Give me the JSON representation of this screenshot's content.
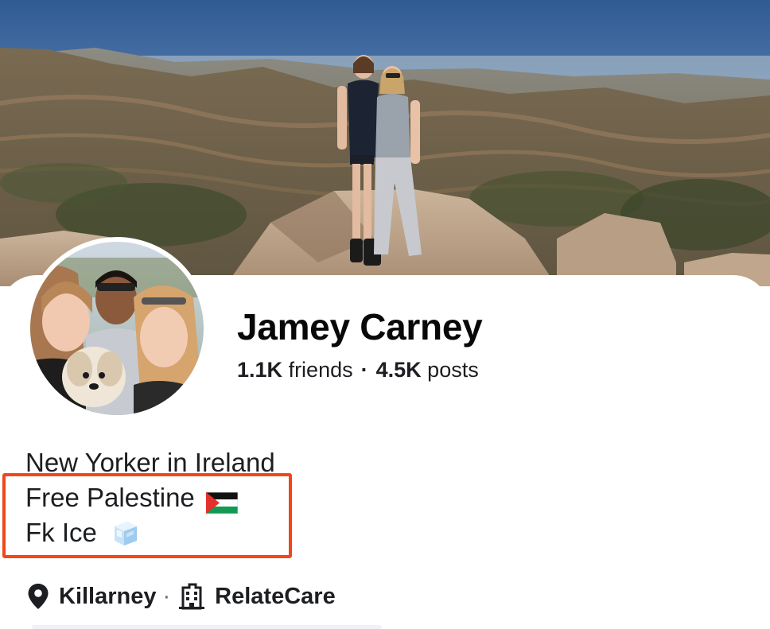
{
  "profile": {
    "name": "Jamey Carney",
    "friends_count": "1.1K",
    "friends_label": "friends",
    "posts_count": "4.5K",
    "posts_label": "posts",
    "separator": "·"
  },
  "bio": {
    "line1": "New Yorker in Ireland",
    "line2": "Free Palestine",
    "line3": "Fk Ice"
  },
  "meta": {
    "location": "Killarney",
    "separator": "·",
    "workplace": "RelateCare"
  },
  "icons": {
    "location": "location-pin-icon",
    "workplace": "building-icon",
    "flag": "palestine-flag-emoji",
    "ice": "ice-cube-emoji"
  },
  "colors": {
    "highlight_box": "#f2461b",
    "text_primary": "#080809",
    "text_secondary": "#1c1e21"
  }
}
